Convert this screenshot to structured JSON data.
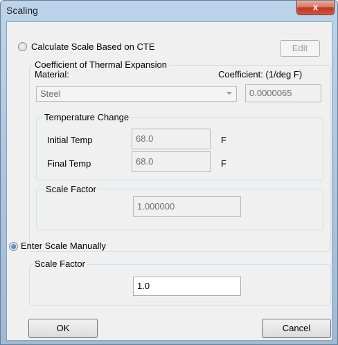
{
  "window": {
    "title": "Scaling",
    "close_glyph": "x"
  },
  "cte": {
    "radio_label": "Calculate Scale Based on CTE",
    "checked": false,
    "edit_label": "Edit",
    "group_title": "Coefficient of Thermal Expansion",
    "material_label": "Material:",
    "coefficient_label": "Coefficient: (1/deg F)",
    "material_value": "Steel",
    "coefficient_value": "0.0000065",
    "temperature": {
      "group_title": "Temperature Change",
      "initial_label": "Initial Temp",
      "initial_value": "68.0",
      "final_label": "Final Temp",
      "final_value": "68.0",
      "unit": "F"
    },
    "scale_factor": {
      "group_title": "Scale Factor",
      "value": "1.000000"
    }
  },
  "manual": {
    "radio_label": "Enter Scale Manually",
    "checked": true,
    "group_title": "Scale Factor",
    "value": "1.0"
  },
  "buttons": {
    "ok": "OK",
    "cancel": "Cancel"
  },
  "icons": {
    "close": "close-icon",
    "radio": "radio-icon",
    "dropdown": "chevron-down-icon"
  }
}
